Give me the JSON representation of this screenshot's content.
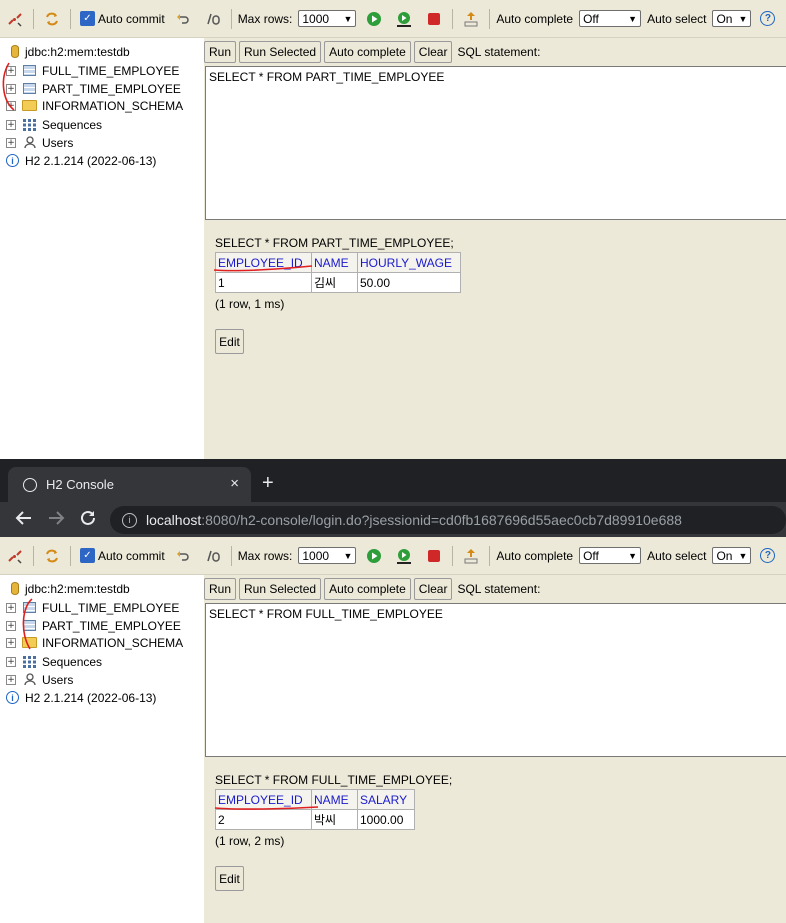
{
  "panes": [
    {
      "toolbar": {
        "auto_commit_label": "Auto commit",
        "max_rows_label": "Max rows:",
        "max_rows_value": "1000",
        "auto_complete_label": "Auto complete",
        "auto_complete_value": "Off",
        "auto_select_label": "Auto select",
        "auto_select_value": "On"
      },
      "tree": {
        "connection": "jdbc:h2:mem:testdb",
        "items": [
          "FULL_TIME_EMPLOYEE",
          "PART_TIME_EMPLOYEE",
          "INFORMATION_SCHEMA",
          "Sequences",
          "Users"
        ],
        "version": "H2 2.1.214 (2022-06-13)"
      },
      "buttons": {
        "run": "Run",
        "run_selected": "Run Selected",
        "auto_complete": "Auto complete",
        "clear": "Clear",
        "sql_statement_label": "SQL statement:"
      },
      "editor_text": "SELECT * FROM PART_TIME_EMPLOYEE",
      "result": {
        "sql": "SELECT * FROM PART_TIME_EMPLOYEE;",
        "columns": [
          "EMPLOYEE_ID",
          "NAME",
          "HOURLY_WAGE"
        ],
        "rows": [
          [
            "1",
            "김씨",
            "50.00"
          ]
        ],
        "summary": "(1 row, 1 ms)",
        "edit_label": "Edit"
      }
    },
    {
      "toolbar": {
        "auto_commit_label": "Auto commit",
        "max_rows_label": "Max rows:",
        "max_rows_value": "1000",
        "auto_complete_label": "Auto complete",
        "auto_complete_value": "Off",
        "auto_select_label": "Auto select",
        "auto_select_value": "On"
      },
      "tree": {
        "connection": "jdbc:h2:mem:testdb",
        "items": [
          "FULL_TIME_EMPLOYEE",
          "PART_TIME_EMPLOYEE",
          "INFORMATION_SCHEMA",
          "Sequences",
          "Users"
        ],
        "version": "H2 2.1.214 (2022-06-13)"
      },
      "buttons": {
        "run": "Run",
        "run_selected": "Run Selected",
        "auto_complete": "Auto complete",
        "clear": "Clear",
        "sql_statement_label": "SQL statement:"
      },
      "editor_text": "SELECT * FROM FULL_TIME_EMPLOYEE",
      "result": {
        "sql": "SELECT * FROM FULL_TIME_EMPLOYEE;",
        "columns": [
          "EMPLOYEE_ID",
          "NAME",
          "SALARY"
        ],
        "rows": [
          [
            "2",
            "박씨",
            "1000.00"
          ]
        ],
        "summary": "(1 row, 2 ms)",
        "edit_label": "Edit"
      }
    }
  ],
  "browser": {
    "tab_title": "H2 Console",
    "tab_close": "×",
    "new_tab": "+",
    "url_host": "localhost",
    "url_rest": ":8080/h2-console/login.do?jsessionid=cd0fb1687696d55aec0cb7d89910e688"
  },
  "colors": {
    "panel_bg": "#ECE9D8",
    "header_link": "#1a1acc",
    "chrome_dark": "#202124",
    "annotation": "#e02020"
  },
  "icons": [
    "disconnect-icon",
    "refresh-icon",
    "rollback-icon",
    "commit-icon",
    "run-icon",
    "run-selected-icon",
    "stop-icon",
    "history-icon",
    "help-icon"
  ]
}
